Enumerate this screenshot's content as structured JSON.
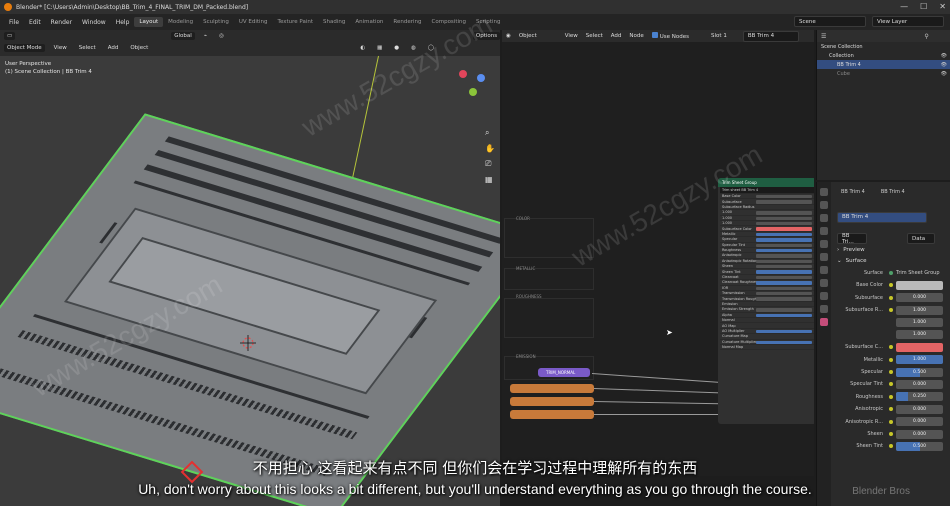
{
  "titlebar": {
    "title": "Blender* [C:\\Users\\Admin\\Desktop\\BB_Trim_4_FINAL_TRIM_DM_Packed.blend]",
    "controls": [
      "—",
      "☐",
      "✕"
    ]
  },
  "menubar": {
    "menus": [
      "File",
      "Edit",
      "Render",
      "Window",
      "Help"
    ],
    "workspaces": [
      "Layout",
      "Modeling",
      "Sculpting",
      "UV Editing",
      "Texture Paint",
      "Shading",
      "Animation",
      "Rendering",
      "Compositing",
      "Scripting"
    ],
    "active_workspace": "Layout",
    "scene": "Scene",
    "view_layer": "View Layer"
  },
  "viewport": {
    "mode": "Object Mode",
    "menus": [
      "View",
      "Select",
      "Add",
      "Object"
    ],
    "orientation": "Global",
    "options": "Options",
    "info_line1": "User Perspective",
    "info_line2": "(1) Scene Collection | BB Trim 4"
  },
  "node_editor": {
    "type": "Object",
    "menus": [
      "View",
      "Select",
      "Add",
      "Node"
    ],
    "use_nodes": "Use Nodes",
    "slot": "Slot 1",
    "material": "BB Trim 4",
    "frames": [
      "COLOR",
      "METALLIC",
      "ROUGHNESS",
      "EMISSION"
    ],
    "nodes": [
      "TRIM_NORMAL"
    ],
    "group_node": {
      "title": "Trim Sheet Group",
      "name": "Trim sheet BB Trim 4",
      "rows": [
        {
          "label": "Base Color",
          "bar": "gray"
        },
        {
          "label": "Subsurface",
          "bar": "gray"
        },
        {
          "label": "Subsurface Radius",
          "bar": "none"
        },
        {
          "label": "1.000",
          "bar": "gray"
        },
        {
          "label": "1.000",
          "bar": "gray"
        },
        {
          "label": "1.000",
          "bar": "gray"
        },
        {
          "label": "Subsurface Color",
          "bar": "red"
        },
        {
          "label": "Metallic",
          "bar": "blue"
        },
        {
          "label": "Specular",
          "bar": "blue"
        },
        {
          "label": "Specular Tint",
          "bar": "gray"
        },
        {
          "label": "Roughness",
          "bar": "blue"
        },
        {
          "label": "Anisotropic",
          "bar": "gray"
        },
        {
          "label": "Anisotropic Rotation",
          "bar": "gray"
        },
        {
          "label": "Sheen",
          "bar": "gray"
        },
        {
          "label": "Sheen Tint",
          "bar": "blue"
        },
        {
          "label": "Clearcoat",
          "bar": "gray"
        },
        {
          "label": "Clearcoat Roughness",
          "bar": "blue"
        },
        {
          "label": "IOR",
          "bar": "gray"
        },
        {
          "label": "Transmission",
          "bar": "gray"
        },
        {
          "label": "Transmission Roughness",
          "bar": "gray"
        },
        {
          "label": "Emission",
          "bar": "none"
        },
        {
          "label": "Emission Strength",
          "bar": "gray"
        },
        {
          "label": "Alpha",
          "bar": "blue"
        },
        {
          "label": "Normal",
          "bar": "none"
        },
        {
          "label": "AO Map",
          "bar": "none"
        },
        {
          "label": "AO Multiplier",
          "bar": "blue"
        },
        {
          "label": "Curvature Map",
          "bar": "none"
        },
        {
          "label": "Curvature Multiplier",
          "bar": "blue"
        },
        {
          "label": "Normal Map",
          "bar": "none"
        }
      ]
    }
  },
  "outliner": {
    "items": [
      {
        "label": "Scene Collection",
        "selected": false
      },
      {
        "label": "Collection",
        "selected": false
      },
      {
        "label": "BB Trim 4",
        "selected": true
      },
      {
        "label": "Cube",
        "selected": false
      }
    ]
  },
  "properties": {
    "object": "BB Trim 4",
    "material_tab": "BB Trim 4",
    "slot_name": "BB Trim 4",
    "data_mode": "Data",
    "preview_label": "Preview",
    "surface_label": "Surface",
    "surface_type": "Trim Sheet Group",
    "rows": [
      {
        "label": "Base Color",
        "value": "",
        "kind": "color-gray",
        "fill": 0
      },
      {
        "label": "Subsurface",
        "value": "0.000",
        "kind": "num",
        "fill": 0
      },
      {
        "label": "Subsurface R...",
        "value": "1.000",
        "kind": "num",
        "fill": 0
      },
      {
        "label": "",
        "value": "1.000",
        "kind": "num",
        "fill": 0
      },
      {
        "label": "",
        "value": "1.000",
        "kind": "num",
        "fill": 0
      },
      {
        "label": "Subsurface C...",
        "value": "",
        "kind": "color-red",
        "fill": 0
      },
      {
        "label": "Metallic",
        "value": "1.000",
        "kind": "num",
        "fill": 1.0
      },
      {
        "label": "Specular",
        "value": "0.500",
        "kind": "num",
        "fill": 0.5
      },
      {
        "label": "Specular Tint",
        "value": "0.000",
        "kind": "num",
        "fill": 0
      },
      {
        "label": "Roughness",
        "value": "0.250",
        "kind": "num",
        "fill": 0.25
      },
      {
        "label": "Anisotropic",
        "value": "0.000",
        "kind": "num",
        "fill": 0
      },
      {
        "label": "Anisotropic R...",
        "value": "0.000",
        "kind": "num",
        "fill": 0
      },
      {
        "label": "Sheen",
        "value": "0.000",
        "kind": "num",
        "fill": 0
      },
      {
        "label": "Sheen Tint",
        "value": "0.500",
        "kind": "num",
        "fill": 0.5
      }
    ]
  },
  "subtitles": {
    "chinese": "不用担心 这看起来有点不同 但你们会在学习过程中理解所有的东西",
    "english": "Uh, don't worry about this looks a bit different, but you'll understand everything as you go through the course."
  },
  "watermark": "www.52cgzy.com",
  "brand": "Blender Bros",
  "colors": {
    "accent": "#4772b3",
    "selection": "#5ed35a",
    "red": "#e36465",
    "node_header": "#1f5e42",
    "node_orange": "#c87a3a",
    "node_purple": "#7a5ac8"
  }
}
